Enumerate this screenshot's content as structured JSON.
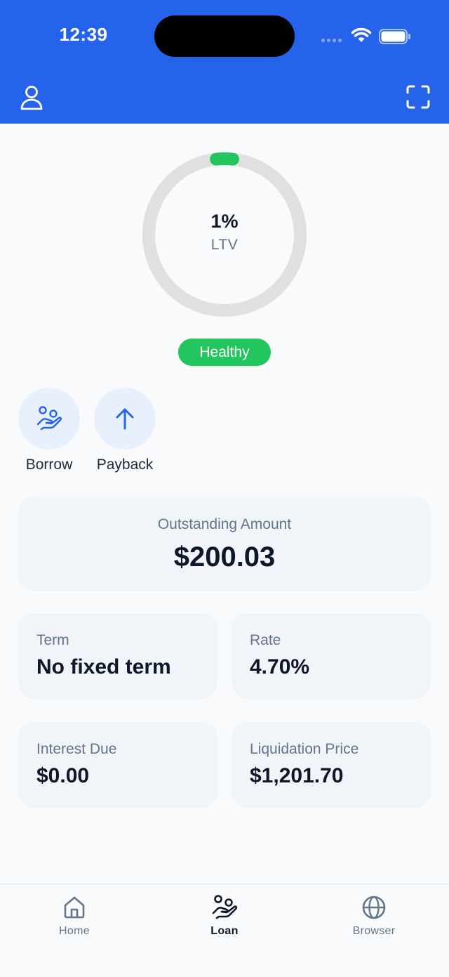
{
  "status_bar": {
    "time": "12:39"
  },
  "ltv": {
    "value": "1%",
    "label": "LTV",
    "fraction": 0.01,
    "track_color": "#e0e0e0",
    "fill_color": "#22c55e"
  },
  "health": {
    "status": "Healthy",
    "color": "#22c55e"
  },
  "actions": [
    {
      "label": "Borrow",
      "icon": "hand-coins-icon"
    },
    {
      "label": "Payback",
      "icon": "arrow-up-icon"
    }
  ],
  "outstanding": {
    "label": "Outstanding Amount",
    "value": "$200.03"
  },
  "details": {
    "term": {
      "label": "Term",
      "value": "No fixed term"
    },
    "rate": {
      "label": "Rate",
      "value": "4.70%"
    },
    "interest_due": {
      "label": "Interest Due",
      "value": "$0.00"
    },
    "liquidation_price": {
      "label": "Liquidation Price",
      "value": "$1,201.70"
    }
  },
  "nav": [
    {
      "label": "Home",
      "icon": "home-icon",
      "active": false
    },
    {
      "label": "Loan",
      "icon": "hand-coins-icon",
      "active": true
    },
    {
      "label": "Browser",
      "icon": "globe-icon",
      "active": false
    }
  ],
  "colors": {
    "header": "#2563eb",
    "accent": "#2563eb",
    "background": "#f8fafc",
    "card": "#f1f5f9"
  }
}
